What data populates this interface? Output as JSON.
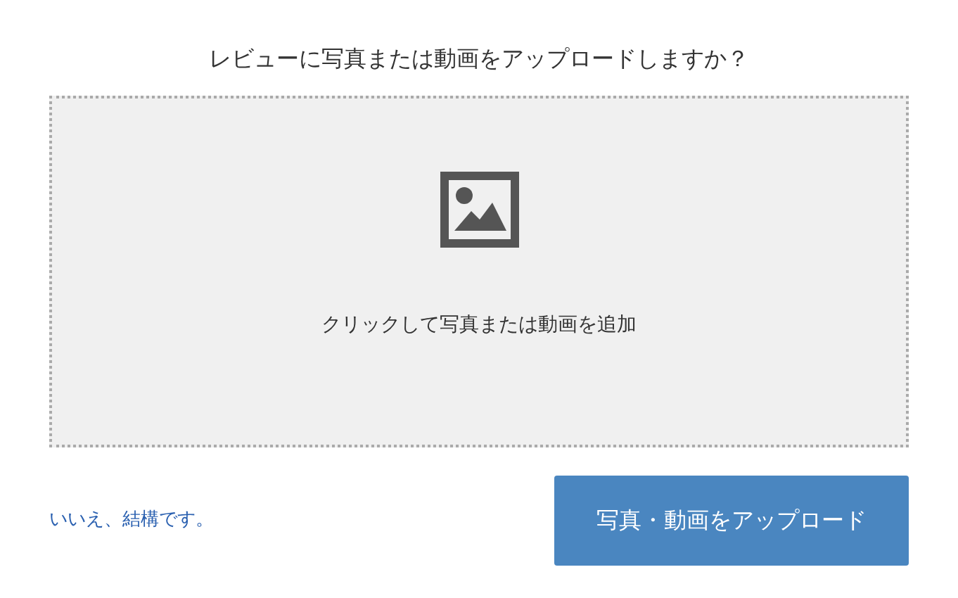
{
  "title": "レビューに写真または動画をアップロードしますか？",
  "dropzone": {
    "label": "クリックして写真または動画を追加"
  },
  "decline_link": "いいえ、結構です。",
  "upload_button": "写真・動画をアップロード"
}
